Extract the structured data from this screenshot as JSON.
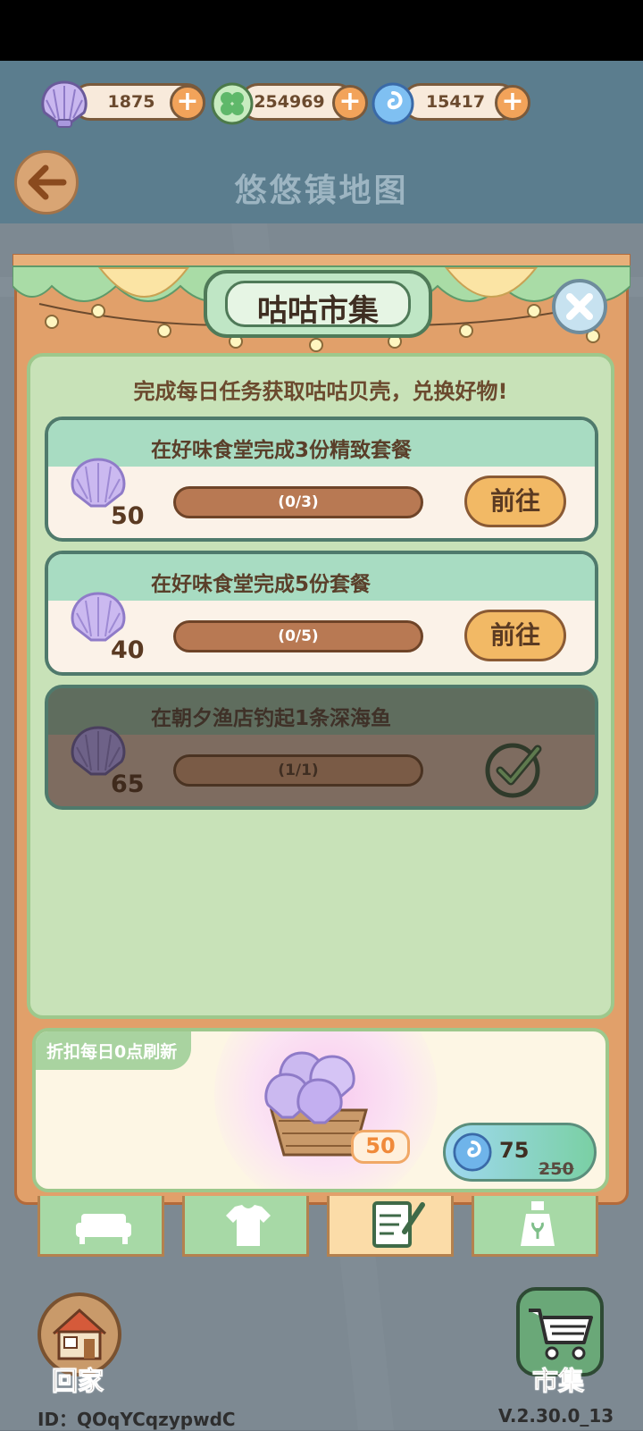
{
  "currencies": {
    "shells": "1875",
    "clover": "254969",
    "swirl": "15417"
  },
  "header": {
    "title": "悠悠镇地图"
  },
  "market": {
    "title": "咕咕市集",
    "subtitle": "完成每日任务获取咕咕贝壳，兑换好物!",
    "tasks": [
      {
        "desc": "在好味食堂完成3份精致套餐",
        "reward": "50",
        "progress": "(0/3)",
        "action": "前往",
        "done": false
      },
      {
        "desc": "在好味食堂完成5份套餐",
        "reward": "40",
        "progress": "(0/5)",
        "action": "前往",
        "done": false
      },
      {
        "desc": "在朝夕渔店钓起1条深海鱼",
        "reward": "65",
        "progress": "(1/1)",
        "done": true
      }
    ],
    "shop": {
      "tag": "折扣每日0点刷新",
      "item_count": "50",
      "price": "75",
      "old_price": "250"
    }
  },
  "tabs": [
    "sofa-icon",
    "shirt-icon",
    "notepad-icon",
    "bottle-icon"
  ],
  "bottom": {
    "home_label": "回家",
    "market_label": "市集",
    "id_text": "ID：QOqYCqzypwdC",
    "version": "V.2.30.0_13"
  },
  "colors": {
    "accent_green": "#a8dcc2",
    "panel_orange": "#e1a06a",
    "button_orange": "#f2b965"
  }
}
